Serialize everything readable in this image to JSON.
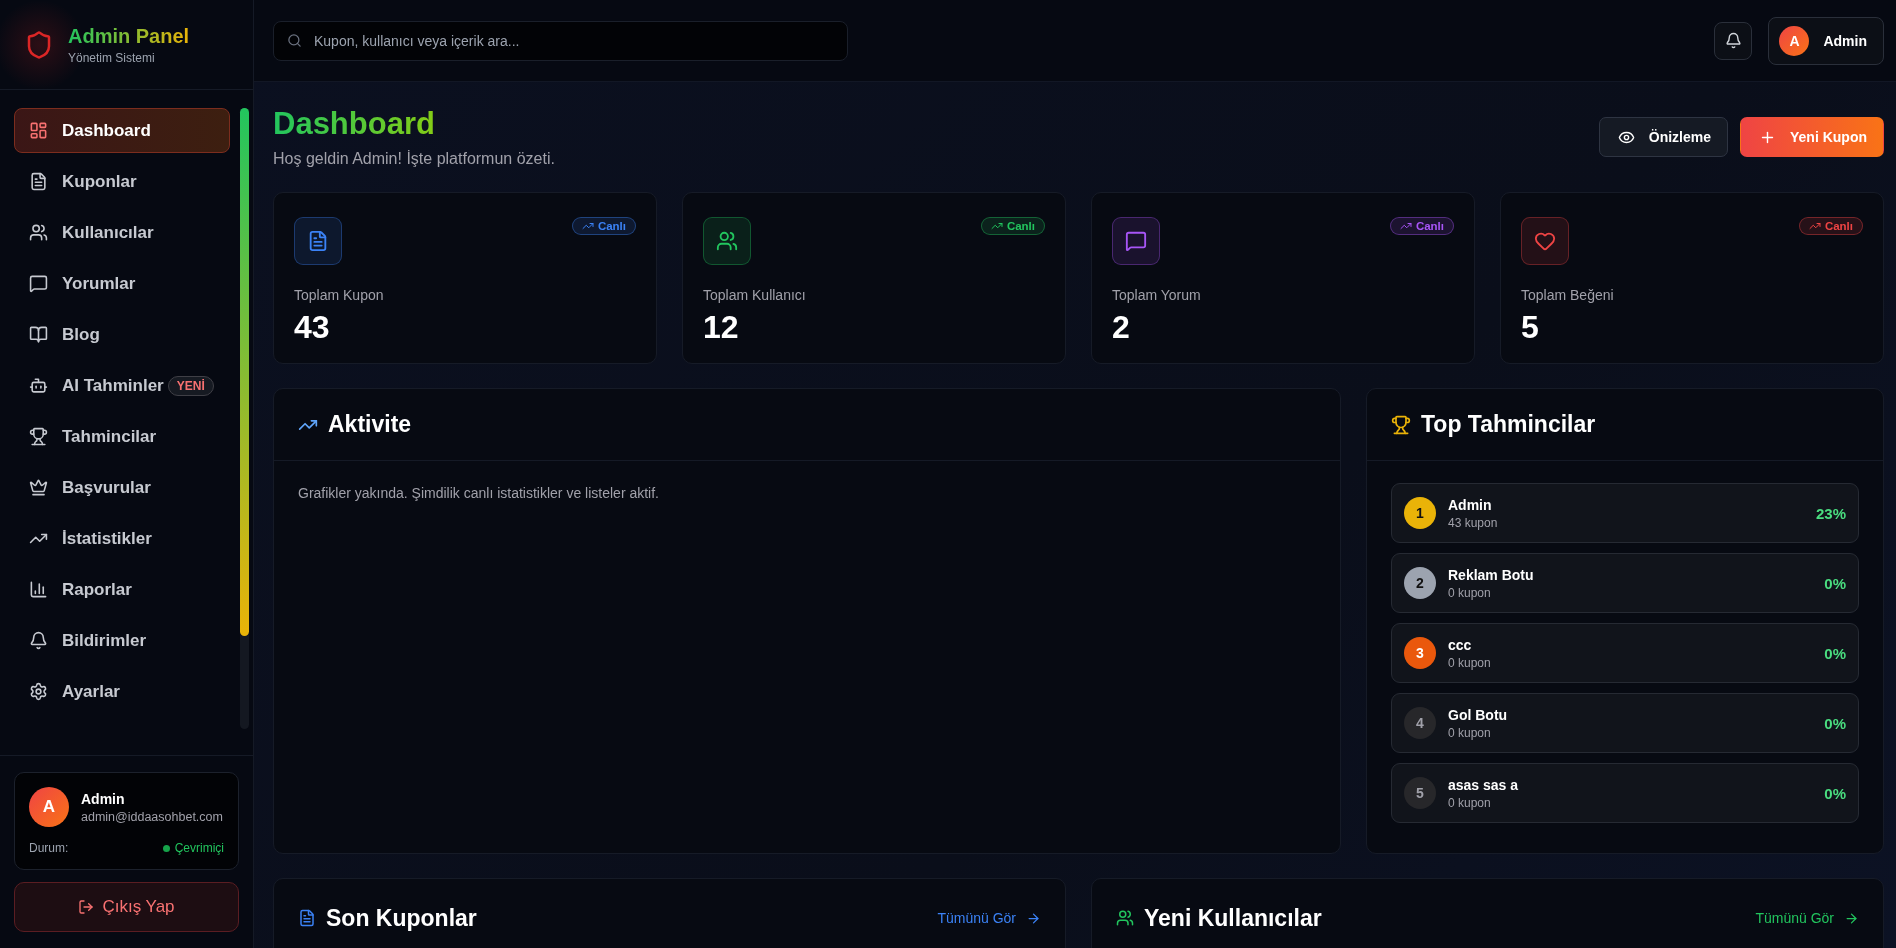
{
  "brand": {
    "title": "Admin Panel",
    "subtitle": "Yönetim Sistemi"
  },
  "sidebar": {
    "items": [
      {
        "label": "Dashboard",
        "selected": true
      },
      {
        "label": "Kuponlar",
        "selected": false
      },
      {
        "label": "Kullanıcılar",
        "selected": false
      },
      {
        "label": "Yorumlar",
        "selected": false
      },
      {
        "label": "Blog",
        "selected": false
      },
      {
        "label": "AI Tahminler",
        "selected": false,
        "badge": "YENİ"
      },
      {
        "label": "Tahmincilar",
        "selected": false
      },
      {
        "label": "Başvurular",
        "selected": false
      },
      {
        "label": "İstatistikler",
        "selected": false
      },
      {
        "label": "Raporlar",
        "selected": false
      },
      {
        "label": "Bildirimler",
        "selected": false
      },
      {
        "label": "Ayarlar",
        "selected": false
      }
    ]
  },
  "user_card": {
    "initial": "A",
    "name": "Admin",
    "email": "admin@iddaasohbet.com",
    "status_label": "Durum:",
    "status": "Çevrimiçi",
    "online": true
  },
  "logout": "Çıkış Yap",
  "topbar": {
    "search": {
      "placeholder": "Kupon, kullanıcı veya içerik ara..."
    },
    "user": {
      "initial": "A",
      "name": "Admin"
    }
  },
  "header": {
    "title": "Dashboard",
    "subtitle": "Hoş geldin Admin! İşte platformun özeti.",
    "buttons": [
      {
        "label": "Önizleme",
        "kind": "secondary"
      },
      {
        "label": "Yeni Kupon",
        "kind": "primary"
      }
    ]
  },
  "stats": [
    {
      "label": "Toplam Kupon",
      "value": "43",
      "badge": "Canlı",
      "color": "#3b82f6"
    },
    {
      "label": "Toplam Kullanıcı",
      "value": "12",
      "badge": "Canlı",
      "color": "#22c55e"
    },
    {
      "label": "Toplam Yorum",
      "value": "2",
      "badge": "Canlı",
      "color": "#a855f7"
    },
    {
      "label": "Toplam Beğeni",
      "value": "5",
      "badge": "Canlı",
      "color": "#ef4444"
    }
  ],
  "activity": {
    "title": "Aktivite",
    "text": "Grafikler yakında. Şimdilik canlı istatistikler ve listeler aktif."
  },
  "top_predictors": {
    "title": "Top Tahmincilar",
    "rows": [
      {
        "rank": "1",
        "name": "Admin",
        "count": "43 kupon",
        "rate": "23%",
        "color": "#eab308"
      },
      {
        "rank": "2",
        "name": "Reklam Botu",
        "count": "0 kupon",
        "rate": "0%",
        "color": "#9ca3af"
      },
      {
        "rank": "3",
        "name": "ccc",
        "count": "0 kupon",
        "rate": "0%",
        "color": "#ea580c"
      },
      {
        "rank": "4",
        "name": "Gol Botu",
        "count": "0 kupon",
        "rate": "0%",
        "color": "#27272a"
      },
      {
        "rank": "5",
        "name": "asas sas a",
        "count": "0 kupon",
        "rate": "0%",
        "color": "#27272a"
      }
    ]
  },
  "bottom_cards": [
    {
      "title": "Son Kuponlar",
      "link": "Tümünü Gör",
      "color": "#3b82f6"
    },
    {
      "title": "Yeni Kullanıcılar",
      "link": "Tümünü Gör",
      "color": "#22c55e"
    }
  ]
}
